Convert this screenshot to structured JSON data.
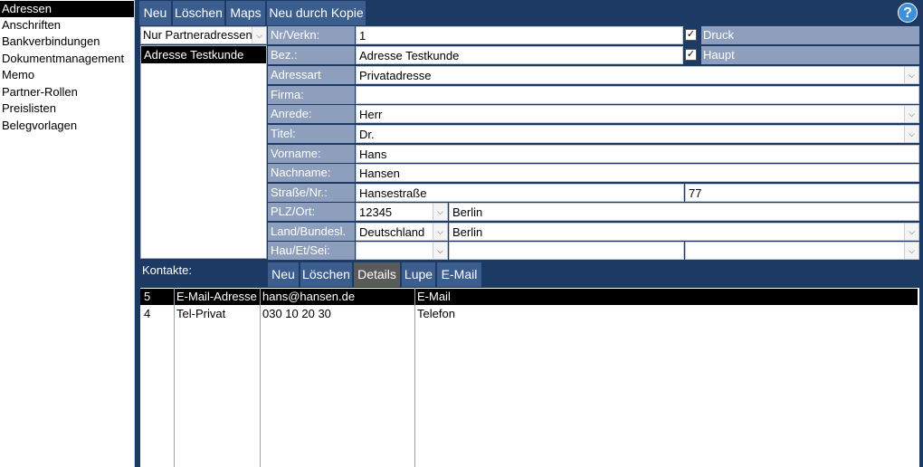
{
  "sidebar": {
    "items": [
      {
        "label": "Adressen"
      },
      {
        "label": "Anschriften"
      },
      {
        "label": "Bankverbindungen"
      },
      {
        "label": "Dokumentmanagement"
      },
      {
        "label": "Memo"
      },
      {
        "label": "Partner-Rollen"
      },
      {
        "label": "Preislisten"
      },
      {
        "label": "Belegvorlagen"
      }
    ]
  },
  "toolbar": {
    "neu": "Neu",
    "loeschen": "Löschen",
    "maps": "Maps",
    "neu_kopie": "Neu durch Kopie",
    "help": "?"
  },
  "filter": {
    "value": "Nur Partneradressen"
  },
  "list": {
    "items": [
      "Adresse Testkunde"
    ]
  },
  "form": {
    "nr_label": "Nr/Verkn:",
    "nr_value": "1",
    "bez_label": "Bez.:",
    "bez_value": "Adresse Testkunde",
    "druck_label": "Druck",
    "haupt_label": "Haupt",
    "adressart_label": "Adressart",
    "adressart_value": "Privatadresse",
    "firma_label": "Firma:",
    "firma_value": "",
    "anrede_label": "Anrede:",
    "anrede_value": "Herr",
    "titel_label": "Titel:",
    "titel_value": "Dr.",
    "vorname_label": "Vorname:",
    "vorname_value": "Hans",
    "nachname_label": "Nachname:",
    "nachname_value": "Hansen",
    "strasse_label": "Straße/Nr.:",
    "strasse_value": "Hansestraße",
    "hausnr_value": "77",
    "plz_label": "PLZ/Ort:",
    "plz_value": "12345",
    "ort_value": "Berlin",
    "land_label": "Land/Bundesl.",
    "land_value": "Deutschland",
    "bundesland_value": "Berlin",
    "hau_label": "Hau/Et/Sei:"
  },
  "contacts": {
    "label": "Kontakte:",
    "buttons": {
      "neu": "Neu",
      "loeschen": "Löschen",
      "details": "Details",
      "lupe": "Lupe",
      "email": "E-Mail"
    },
    "rows": [
      {
        "nr": "5",
        "type": "E-Mail-Adresse",
        "value": "hans@hansen.de",
        "kind": "E-Mail"
      },
      {
        "nr": "4",
        "type": "Tel-Privat",
        "value": "030 10 20 30",
        "kind": "Telefon"
      }
    ]
  }
}
